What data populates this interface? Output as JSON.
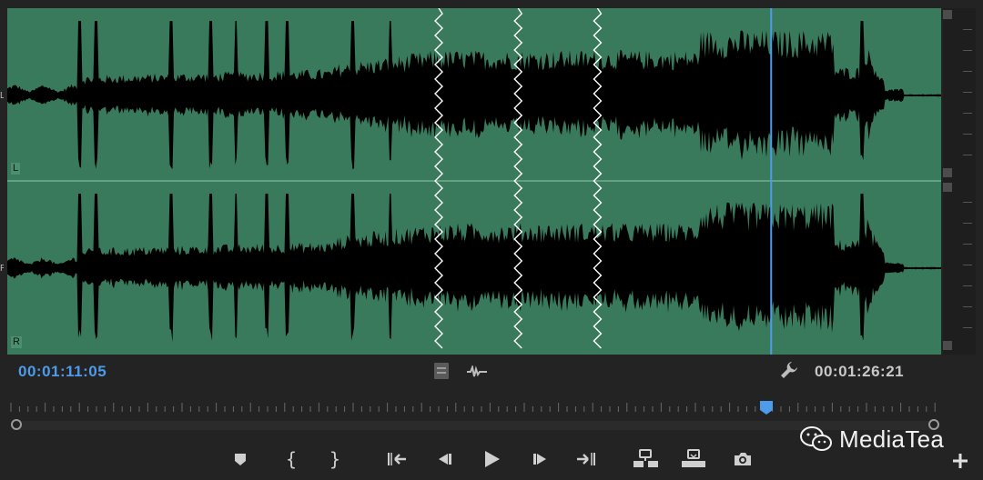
{
  "channels": [
    {
      "label": "L"
    },
    {
      "label": "R"
    }
  ],
  "edge_labels": {
    "left_channel": "L",
    "right_channel": "R"
  },
  "timecode": {
    "current": "00:01:11:05",
    "duration": "00:01:26:21"
  },
  "playhead_position": 0.818,
  "waveform": {
    "fill_color": "#3a7a5c",
    "wave_color": "#000000",
    "playhead_color": "#4d9bea",
    "break_positions": [
      0.462,
      0.547,
      0.632
    ]
  },
  "icons": {
    "settings": "wrench-icon",
    "lanes": "lane-toggle-icon",
    "scrub": "scrub-audio-icon"
  },
  "transport": {
    "buttons": [
      {
        "name": "add-marker-button",
        "icon": "marker-icon"
      },
      {
        "name": "mark-in-button",
        "icon": "mark-in-icon"
      },
      {
        "name": "mark-out-button",
        "icon": "mark-out-icon"
      },
      {
        "name": "go-to-in-button",
        "icon": "go-to-in-icon"
      },
      {
        "name": "step-back-button",
        "icon": "step-back-icon"
      },
      {
        "name": "play-button",
        "icon": "play-icon"
      },
      {
        "name": "step-forward-button",
        "icon": "step-forward-icon"
      },
      {
        "name": "go-to-out-button",
        "icon": "go-to-out-icon"
      },
      {
        "name": "insert-button",
        "icon": "insert-icon"
      },
      {
        "name": "overwrite-button",
        "icon": "overwrite-icon"
      },
      {
        "name": "export-frame-button",
        "icon": "camera-icon"
      }
    ]
  },
  "watermark": {
    "text": "MediaTea",
    "icon": "wechat-icon"
  }
}
